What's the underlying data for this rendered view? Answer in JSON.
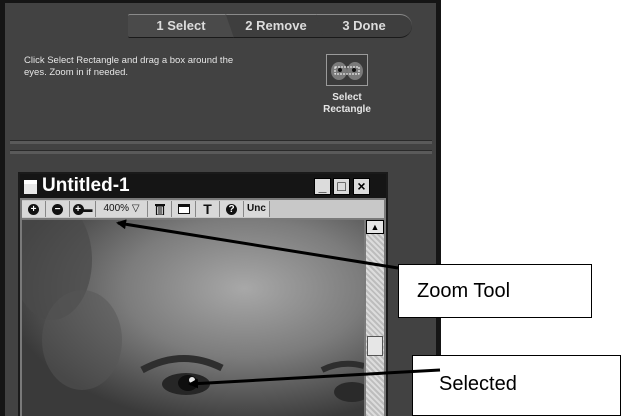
{
  "steps": [
    {
      "label": "1 Select"
    },
    {
      "label": "2 Remove"
    },
    {
      "label": "3 Done"
    }
  ],
  "instruction": "Click Select Rectangle and drag a box around the eyes. Zoom in if needed.",
  "select_rectangle": {
    "line1": "Select",
    "line2": "Rectangle",
    "icon": "eyes-thumbnail-icon"
  },
  "document": {
    "title": "Untitled-1",
    "window_buttons": {
      "minimize": "_",
      "maximize": "□",
      "close": "×"
    },
    "toolbar": {
      "zoom_in": "+",
      "zoom_out": "−",
      "zoom_tool": "+",
      "zoom_level": "400%",
      "zoom_dropdown": "▽",
      "trash": "🗑",
      "text_tool": "T",
      "help": "?",
      "undo_partial": "Unc",
      "scroll_up": "▲"
    }
  },
  "callouts": {
    "zoom_tool": "Zoom Tool",
    "selected": "Selected"
  }
}
